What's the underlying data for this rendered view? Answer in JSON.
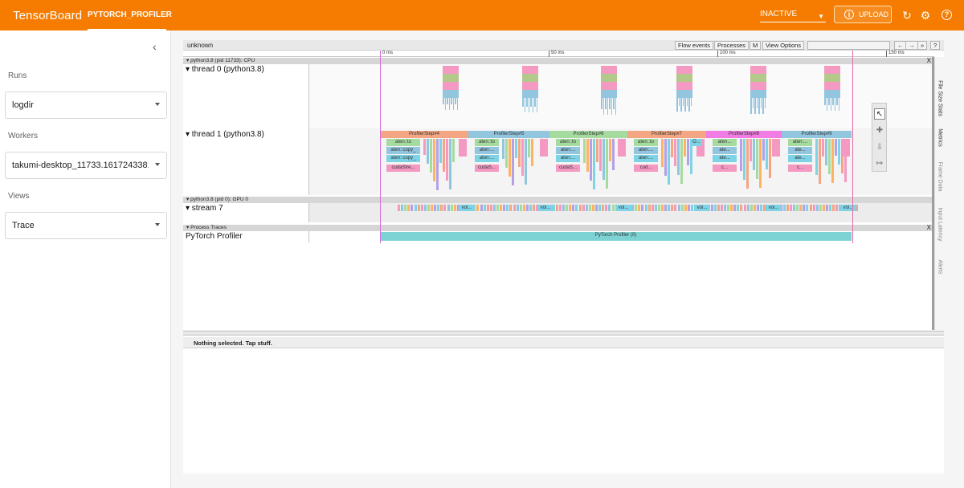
{
  "app": {
    "title": "TensorBoard",
    "active_plugin": "PYTORCH_PROFILER",
    "run_state": "INACTIVE",
    "upload_label": "UPLOAD",
    "accent_color": "#f57c00"
  },
  "sidebar": {
    "runs_label": "Runs",
    "runs_value": "logdir",
    "workers_label": "Workers",
    "workers_value": "takumi-desktop_11733.1617243381...",
    "views_label": "Views",
    "views_value": "Trace"
  },
  "trace": {
    "process_name": "unknown",
    "buttons": {
      "flow_events": "Flow events",
      "processes": "Processes",
      "m": "M",
      "view_options": "View Options",
      "nav_back": "←",
      "nav_fwd": "→",
      "nav_right": "»",
      "help": "?"
    },
    "ruler": [
      "0 ms",
      "50 ms",
      "100 ms",
      "150 ms"
    ],
    "cpu_section": "python3.8 (pid 11733): CPU",
    "thread0": "▾ thread 0 (python3.8)",
    "thread1": "▾ thread 1 (python3.8)",
    "gpu_section": "python3.8 (pid 0): GPU 0",
    "stream": "▾ stream 7",
    "process_traces_section": "Process Traces",
    "profiler_label": "PyTorch Profiler",
    "profiler_bar": "PyTorch Profiler (0)",
    "steps": [
      {
        "label": "ProfilerStep#4",
        "color": "#f4a582"
      },
      {
        "label": "ProfilerStep#5",
        "color": "#92c5de"
      },
      {
        "label": "ProfilerStep#6",
        "color": "#a6dba0"
      },
      {
        "label": "ProfilerStep#7",
        "color": "#f4a582"
      },
      {
        "label": "ProfilerStep#8",
        "color": "#f17ce3"
      },
      {
        "label": "ProfilerStep#9",
        "color": "#92c5de"
      }
    ],
    "sub_labels": [
      [
        "aten::to",
        "aten::copy_",
        "aten::copy_",
        "cudaStre..."
      ],
      [
        "aten::to",
        "aten:...",
        "aten:...",
        "cudaS..."
      ],
      [
        "aten::to",
        "aten:...",
        "aten:...",
        "cudaS..."
      ],
      [
        "aten::to",
        "aten:...",
        "aten:...",
        "cud..."
      ],
      [
        "aten...",
        "ate...",
        "ate...",
        "c..."
      ],
      [
        "aten:...",
        "ate...",
        "ate...",
        "c..."
      ]
    ],
    "step8_extra": "O...",
    "gpu_kernel_label": "voi...",
    "right_tabs": [
      "File Size Stats",
      "Metrics",
      "Frame Data",
      "Input Latency",
      "Alerts"
    ],
    "selection_text": "Nothing selected. Tap stuff."
  }
}
